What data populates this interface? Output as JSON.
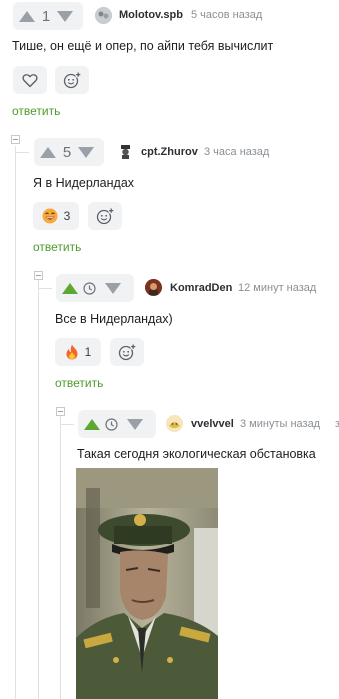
{
  "comments": [
    {
      "author": "Molotov.spb",
      "time": "5 часов назад",
      "rating": "1",
      "text": "Тише, он ещё и опер, по айпи тебя вычислит",
      "reply_label": "ответить"
    },
    {
      "author": "cpt.Zhurov",
      "time": "3 часа назад",
      "rating": "5",
      "text": "Я в Нидерландах",
      "reaction_count": "3",
      "reply_label": "ответить"
    },
    {
      "author": "KomradDen",
      "time": "12 минут назад",
      "text": "Все в Нидерландах)",
      "reaction_count": "1",
      "reply_label": "ответить"
    },
    {
      "author": "vvelvvel",
      "time": "3 минуты назад",
      "text": "Такая сегодня экологическая обстановка"
    }
  ],
  "colors": {
    "accent_green": "#5ca832",
    "reply_green": "#4e9a2c",
    "vote_bg": "#f1f2f4",
    "thread_line": "#dfe2e5"
  },
  "icons": {
    "heart": "heart-icon",
    "add_reaction": "add-reaction-icon",
    "reaction_smile": "grinning-face-icon",
    "reaction_fire": "fire-icon",
    "clock": "clock-icon"
  }
}
